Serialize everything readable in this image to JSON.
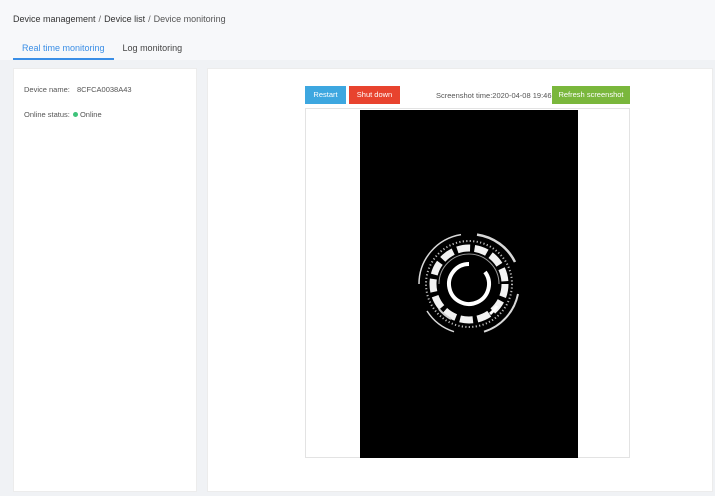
{
  "breadcrumb": {
    "items": [
      "Device management",
      "Device list",
      "Device monitoring"
    ],
    "separator": "/"
  },
  "tabs": [
    {
      "label": "Real time monitoring",
      "active": true
    },
    {
      "label": "Log monitoring",
      "active": false
    }
  ],
  "device": {
    "name_label": "Device name:",
    "name_value": "8CFCA0038A43",
    "status_label": "Online status:",
    "status_value": "Online",
    "status_color": "#3ec37a"
  },
  "actions": {
    "restart_label": "Restart",
    "shutdown_label": "Shut down",
    "refresh_label": "Refresh screenshot"
  },
  "screenshot": {
    "time_label": "Screenshot time:",
    "time_value": "2020-04-08 19:46"
  },
  "colors": {
    "accent": "#3a8ee6",
    "restart": "#3da7e0",
    "shutdown": "#e8432e",
    "refresh": "#7ab73c"
  }
}
